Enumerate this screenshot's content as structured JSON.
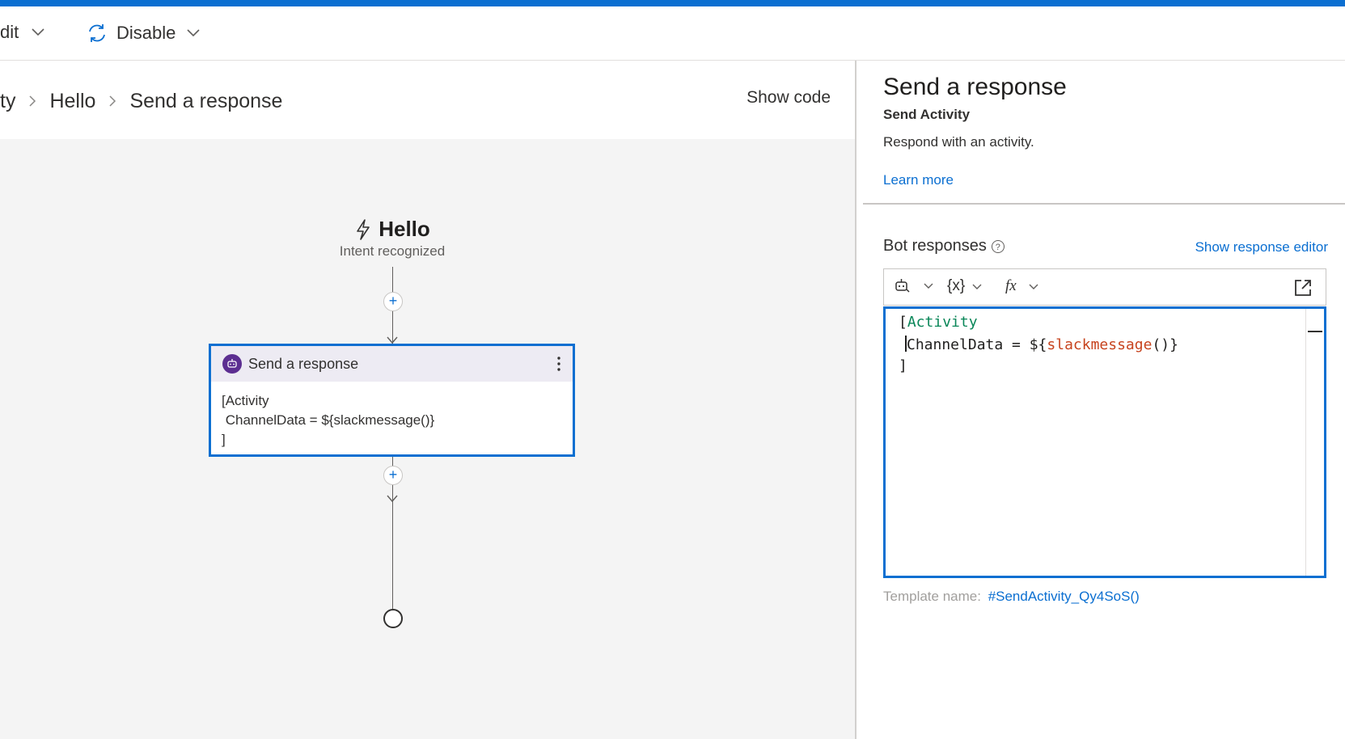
{
  "toolbar": {
    "edit_label": "dit",
    "disable_label": "Disable"
  },
  "breadcrumb": {
    "items": [
      "ty",
      "Hello",
      "Send a response"
    ]
  },
  "canvas": {
    "show_code_label": "Show code",
    "trigger": {
      "title": "Hello",
      "subtitle": "Intent recognized",
      "icon": "lightning-icon"
    },
    "action_card": {
      "title": "Send a response",
      "icon": "bot-icon",
      "body_lines": [
        "[Activity",
        " ChannelData = ${slackmessage()}",
        "]"
      ]
    }
  },
  "properties": {
    "title": "Send a response",
    "subtitle": "Send Activity",
    "description": "Respond with an activity.",
    "learn_more": "Learn more",
    "bot_responses_label": "Bot responses",
    "show_response_editor": "Show response editor",
    "editor_toolbar": {
      "bot_icon": "bot-icon",
      "variables_label": "{x}",
      "functions_label": "fx"
    },
    "code": {
      "line1_bracket": "[",
      "line1_keyword": "Activity",
      "line2_key": "ChannelData = ${",
      "line2_func": "slackmessage",
      "line2_tail": "()}",
      "line3": "]"
    },
    "template_label": "Template name:",
    "template_value": "#SendActivity_Qy4SoS()"
  },
  "colors": {
    "accent": "#0b6fd1",
    "bot_badge": "#5c2e91",
    "code_keyword": "#098658",
    "code_function": "#c7441f"
  }
}
